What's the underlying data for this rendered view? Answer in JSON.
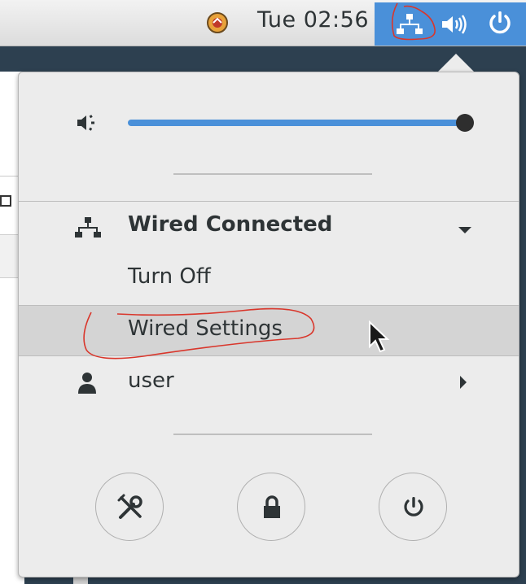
{
  "topbar": {
    "clock": "Tue 02:56",
    "activity_icon": "app-indicator-icon",
    "status_icons": [
      "network-wired-icon",
      "volume-icon",
      "power-icon"
    ]
  },
  "menu": {
    "volume": {
      "icon": "speaker-icon",
      "level": 1.0
    },
    "network": {
      "title": "Wired Connected",
      "items": [
        "Turn Off",
        "Wired Settings"
      ]
    },
    "user": {
      "label": "user"
    },
    "buttons": [
      "settings-icon",
      "lock-icon",
      "power-off-icon"
    ]
  },
  "colors": {
    "accent": "#4a90d9",
    "menu_bg": "#ececec",
    "highlight": "#d4d4d4",
    "annotation": "#d9362b"
  }
}
